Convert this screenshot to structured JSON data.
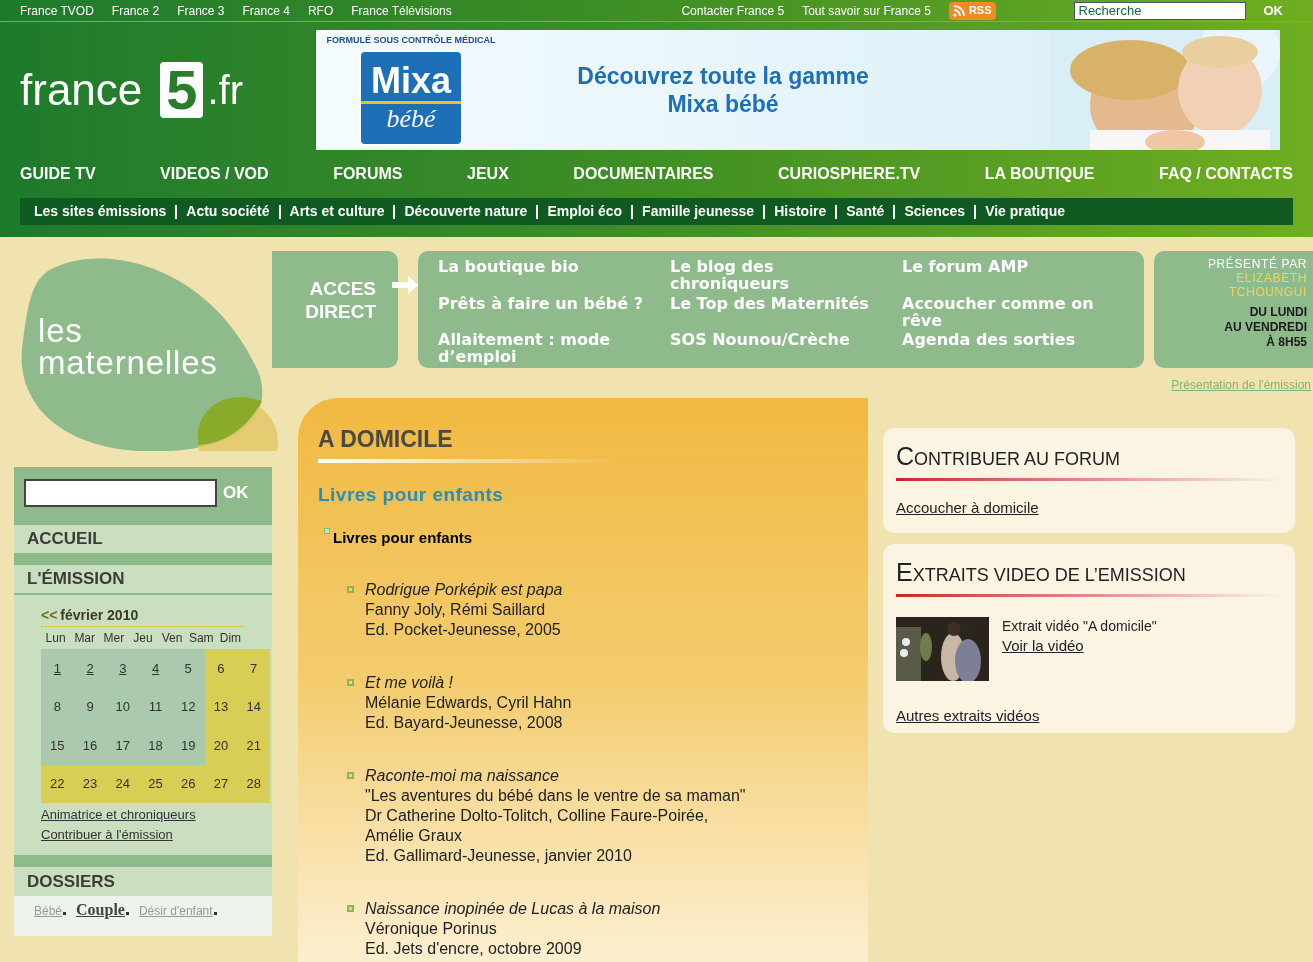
{
  "top_bar": {
    "left_links": [
      "France TVOD",
      "France 2",
      "France 3",
      "France 4",
      "RFO",
      "France Télévisions"
    ],
    "right_links": [
      "Contacter France 5",
      "Tout savoir sur France 5"
    ],
    "rss": "RSS",
    "search": {
      "value": "Recherche",
      "button": "OK"
    }
  },
  "logo": {
    "word": "france",
    "number": "5",
    "suffix": ".fr"
  },
  "ad": {
    "badge": "FORMULÉ SOUS CONTRÔLE MÉDICAL",
    "brand": "Mixa",
    "brand_sub": "bébé",
    "headline": [
      "Découvrez toute la gamme",
      "Mixa bébé"
    ],
    "kind": "picture"
  },
  "main_nav": [
    "GUIDE TV",
    "VIDEOS / VOD",
    "FORUMS",
    "JEUX",
    "DOCUMENTAIRES",
    "CURIOSPHERE.TV",
    "LA BOUTIQUE",
    "FAQ / CONTACTS"
  ],
  "sub_nav": [
    "Les sites émissions",
    "Actu société",
    "Arts et culture",
    "Découverte nature",
    "Emploi éco",
    "Famille jeunesse",
    "Histoire",
    "Santé",
    "Sciences",
    "Vie pratique"
  ],
  "show": {
    "title_top": "les",
    "title_bottom": "maternelles"
  },
  "acces_direct": {
    "label": [
      "ACCES",
      "DIRECT"
    ],
    "links": [
      "La boutique bio",
      "Le blog des chroniqueurs",
      "Le forum AMP",
      "Prêts à faire un bébé ?",
      "Le Top des Maternités",
      "Accoucher comme on rêve",
      "Allaitement : mode d’emploi",
      "SOS Nounou/Crèche",
      "Agenda des sorties"
    ]
  },
  "presenter": {
    "label": "PRÉSENTÉ PAR",
    "name": [
      "ELIZABETH",
      "TCHOUNGUI"
    ],
    "schedule": [
      "DU LUNDI",
      "AU VENDREDI",
      "À 8H55"
    ],
    "link": "Présentation de l'émission"
  },
  "sidebar": {
    "search": {
      "button": "OK"
    },
    "sections": [
      "ACCUEIL",
      "L'ÉMISSION"
    ],
    "calendar": {
      "prev": "<<",
      "month": "février 2010",
      "weekdays": [
        "Lun",
        "Mar",
        "Mer",
        "Jeu",
        "Ven",
        "Sam",
        "Dim"
      ],
      "weeks": [
        [
          {
            "day": "1",
            "linked": true,
            "highlighted": false
          },
          {
            "day": "2",
            "linked": true,
            "highlighted": false
          },
          {
            "day": "3",
            "linked": true,
            "highlighted": false
          },
          {
            "day": "4",
            "linked": true,
            "highlighted": false
          },
          {
            "day": "5",
            "linked": false,
            "highlighted": false
          },
          {
            "day": "6",
            "linked": false,
            "highlighted": true
          },
          {
            "day": "7",
            "linked": false,
            "highlighted": true
          }
        ],
        [
          {
            "day": "8",
            "linked": false,
            "highlighted": false
          },
          {
            "day": "9",
            "linked": false,
            "highlighted": false
          },
          {
            "day": "10",
            "linked": false,
            "highlighted": false
          },
          {
            "day": "11",
            "linked": false,
            "highlighted": false
          },
          {
            "day": "12",
            "linked": false,
            "highlighted": false
          },
          {
            "day": "13",
            "linked": false,
            "highlighted": true
          },
          {
            "day": "14",
            "linked": false,
            "highlighted": true
          }
        ],
        [
          {
            "day": "15",
            "linked": false,
            "highlighted": false
          },
          {
            "day": "16",
            "linked": false,
            "highlighted": false
          },
          {
            "day": "17",
            "linked": false,
            "highlighted": false
          },
          {
            "day": "18",
            "linked": false,
            "highlighted": false
          },
          {
            "day": "19",
            "linked": false,
            "highlighted": false
          },
          {
            "day": "20",
            "linked": false,
            "highlighted": true
          },
          {
            "day": "21",
            "linked": false,
            "highlighted": true
          }
        ],
        [
          {
            "day": "22",
            "linked": false,
            "highlighted": true
          },
          {
            "day": "23",
            "linked": false,
            "highlighted": true
          },
          {
            "day": "24",
            "linked": false,
            "highlighted": true
          },
          {
            "day": "25",
            "linked": false,
            "highlighted": true
          },
          {
            "day": "26",
            "linked": false,
            "highlighted": true
          },
          {
            "day": "27",
            "linked": false,
            "highlighted": true
          },
          {
            "day": "28",
            "linked": false,
            "highlighted": true
          }
        ]
      ]
    },
    "links": [
      "Animatrice et chroniqueurs",
      "Contribuer à l'émission"
    ],
    "dossiers": {
      "title": "DOSSIERS",
      "tags": [
        {
          "label": "Bébé",
          "emphasized": false
        },
        {
          "label": "Couple",
          "emphasized": true
        },
        {
          "label": "Désir d'enfant",
          "emphasized": false
        }
      ]
    }
  },
  "article": {
    "title": "A DOMICILE",
    "subtitle": "Livres pour enfants",
    "list_heading": "Livres pour enfants",
    "books": [
      {
        "title": "Rodrigue Porképik est papa",
        "lines": [
          "Fanny Joly, Rémi Saillard",
          "Ed. Pocket-Jeunesse, 2005"
        ]
      },
      {
        "title": "Et me voilà !",
        "lines": [
          "Mélanie Edwards, Cyril Hahn",
          "Ed. Bayard-Jeunesse, 2008"
        ]
      },
      {
        "title": "Raconte-moi ma naissance",
        "lines": [
          "\"Les aventures du bébé dans le ventre de sa maman\"",
          "Dr Catherine Dolto-Tolitch, Colline Faure-Poirée,",
          "Amélie Graux",
          "Ed. Gallimard-Jeunesse, janvier 2010"
        ]
      },
      {
        "title": "Naissance inopinée de Lucas à la maison",
        "lines": [
          "Véronique Porinus",
          "Ed. Jets d'encre, octobre 2009"
        ]
      }
    ]
  },
  "forum": {
    "title": "CONTRIBUER AU FORUM",
    "link": "Accoucher à domicile"
  },
  "videos": {
    "title": "EXTRAITS VIDEO DE L’EMISSION",
    "caption": "Extrait vidéo \"A domicile\"",
    "link": "Voir la vidéo",
    "more": "Autres extraits vidéos"
  }
}
